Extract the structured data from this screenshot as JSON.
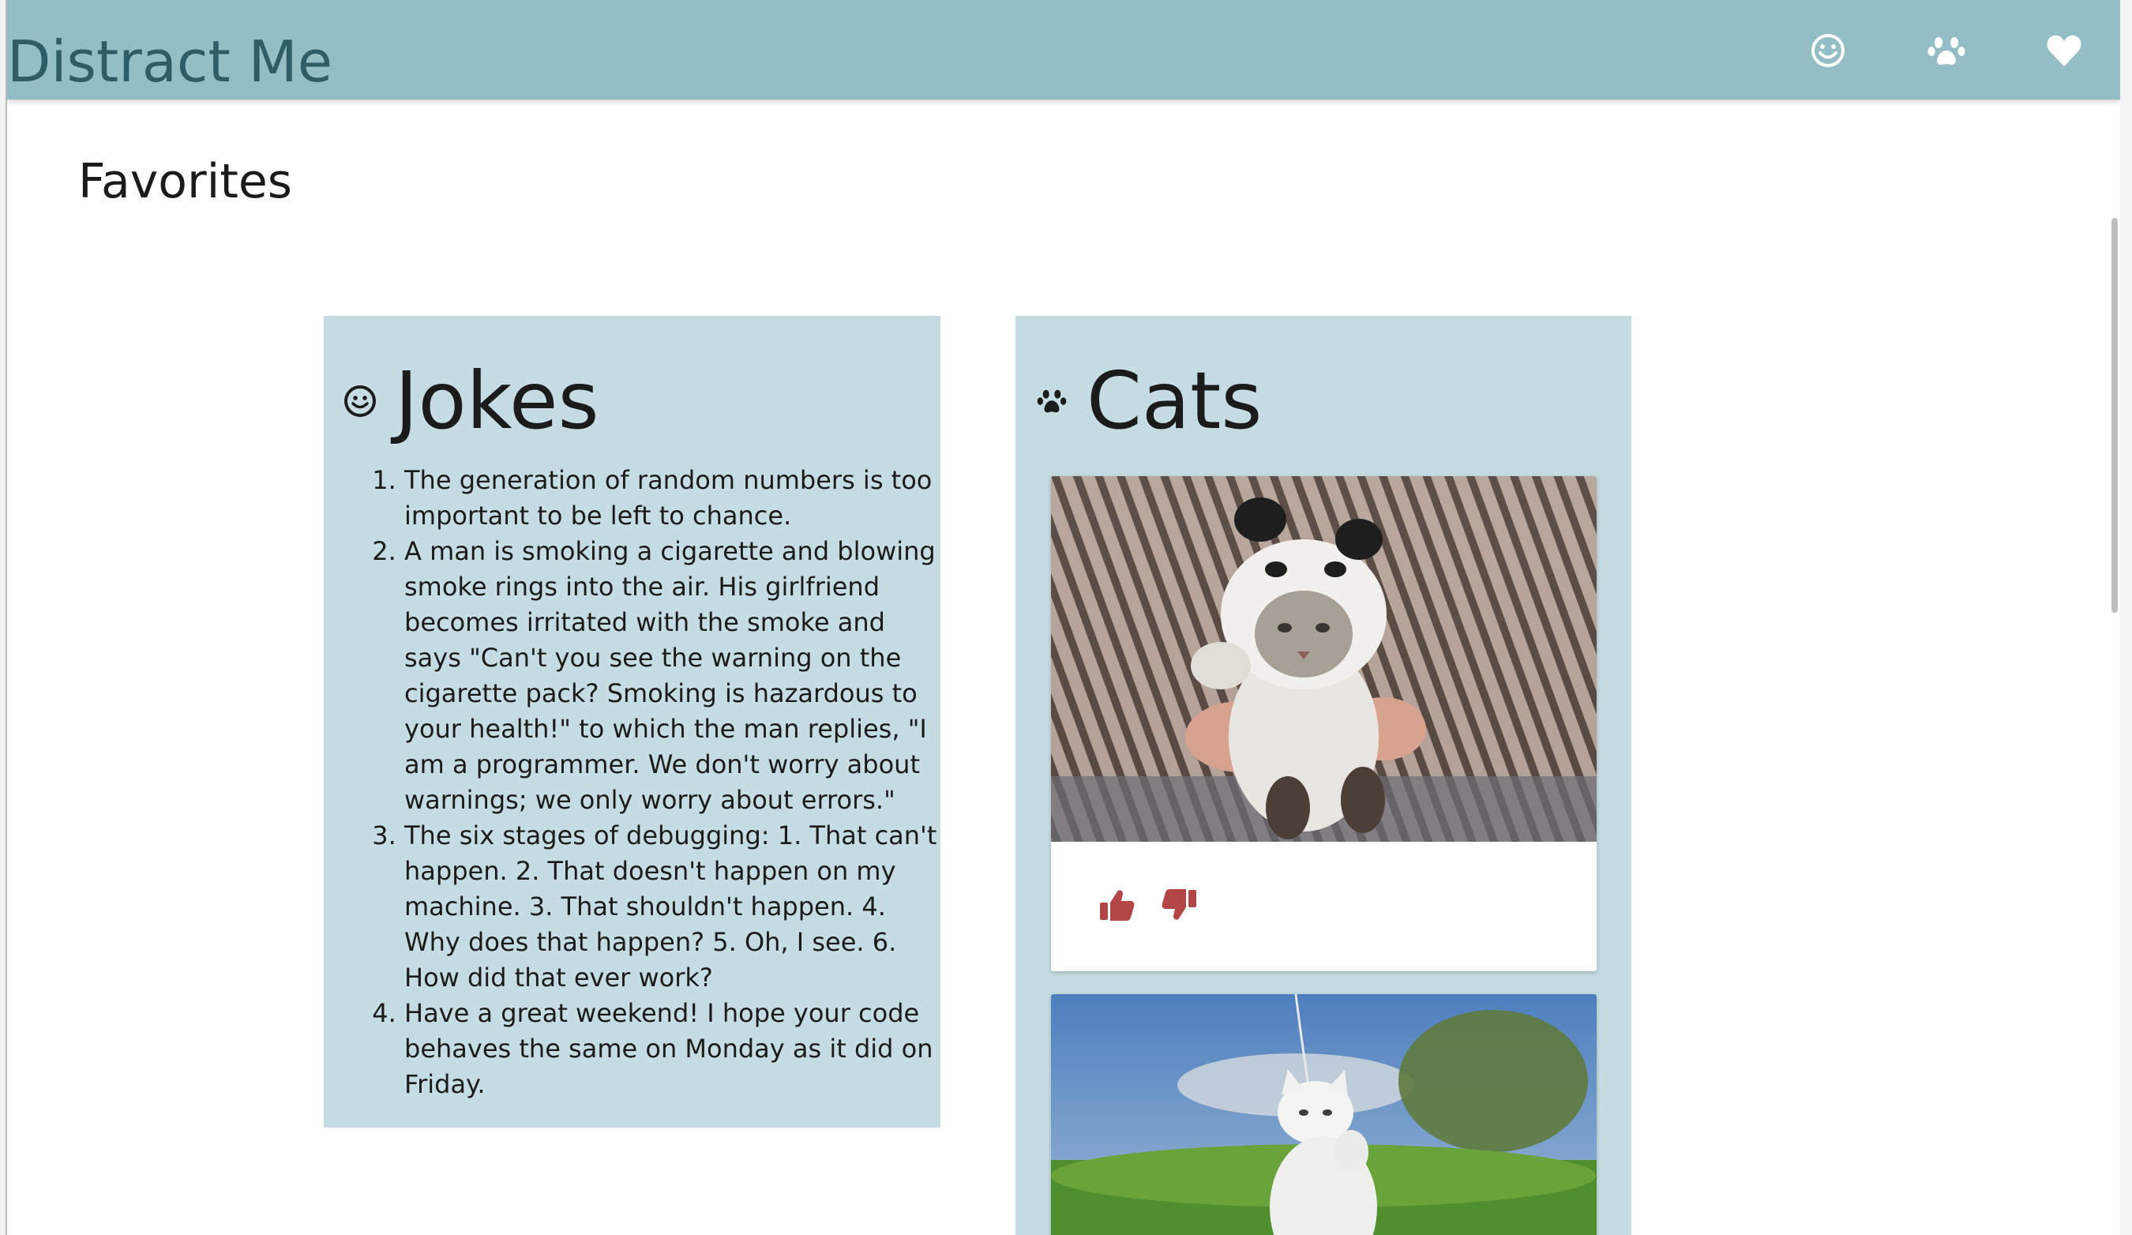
{
  "app": {
    "title": "Distract Me"
  },
  "nav": {
    "items": [
      {
        "icon": "smiley-icon",
        "target": "jokes"
      },
      {
        "icon": "paw-icon",
        "target": "cats"
      },
      {
        "icon": "heart-icon",
        "target": "favorites"
      }
    ]
  },
  "page": {
    "title": "Favorites"
  },
  "jokes": {
    "title": "Jokes",
    "icon": "smiley-icon",
    "items": [
      "The generation of random numbers is too important to be left to chance.",
      "A man is smoking a cigarette and blowing smoke rings into the air. His girlfriend becomes irritated with the smoke and says \"Can't you see the warning on the cigarette pack? Smoking is hazardous to your health!\" to which the man replies, \"I am a programmer. We don't worry about warnings; we only worry about errors.\"",
      "The six stages of debugging: 1. That can't happen. 2. That doesn't happen on my machine. 3. That shouldn't happen. 4. Why does that happen? 5. Oh, I see. 6. How did that ever work?",
      "Have a great weekend! I hope your code behaves the same on Monday as it did on Friday."
    ]
  },
  "cats": {
    "title": "Cats",
    "icon": "paw-icon",
    "cards": [
      {
        "photo": "cat-in-panda-hat-photo",
        "actions": [
          "thumbs-up-icon",
          "thumbs-down-icon"
        ]
      },
      {
        "photo": "white-kitten-playing-photo"
      }
    ]
  },
  "colors": {
    "topbar": "#93bec6",
    "brand_text": "#2e5c67",
    "column_bg": "#c5dde2",
    "vote_icon": "#b24646"
  }
}
